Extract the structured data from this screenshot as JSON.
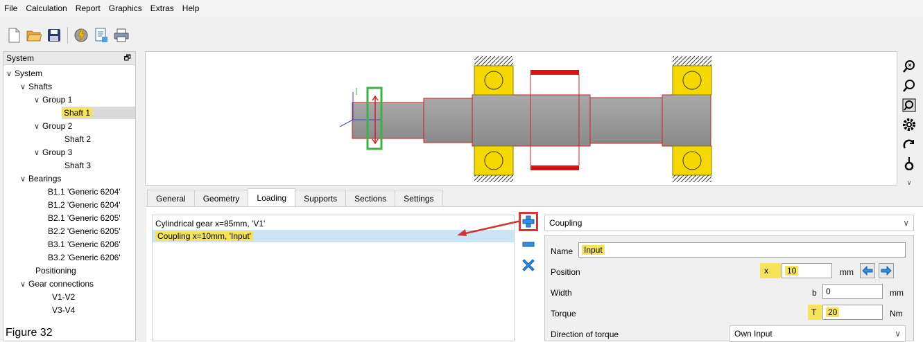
{
  "menu": [
    "File",
    "Calculation",
    "Report",
    "Graphics",
    "Extras",
    "Help"
  ],
  "toolbar": {
    "icons": [
      "new-document-icon",
      "open-folder-icon",
      "save-icon",
      "calculate-icon",
      "report-icon",
      "print-icon"
    ]
  },
  "system_panel": {
    "title": "System",
    "tree": [
      {
        "label": "System",
        "level": 0,
        "expanded": true
      },
      {
        "label": "Shafts",
        "level": 1,
        "expanded": true
      },
      {
        "label": "Group 1",
        "level": 2,
        "expanded": true
      },
      {
        "label": "Shaft 1",
        "level": 3,
        "selected": true
      },
      {
        "label": "Group 2",
        "level": 2,
        "expanded": true
      },
      {
        "label": "Shaft 2",
        "level": 3
      },
      {
        "label": "Group 3",
        "level": 2,
        "expanded": true
      },
      {
        "label": "Shaft 3",
        "level": 3
      },
      {
        "label": "Bearings",
        "level": 1,
        "expanded": true
      },
      {
        "label": "B1.1 'Generic 6204'",
        "level": 2
      },
      {
        "label": "B1.2 'Generic 6204'",
        "level": 2
      },
      {
        "label": "B2.1 'Generic 6205'",
        "level": 2
      },
      {
        "label": "B2.2 'Generic 6205'",
        "level": 2
      },
      {
        "label": "B3.1 'Generic 6206'",
        "level": 2
      },
      {
        "label": "B3.2 'Generic 6206'",
        "level": 2
      },
      {
        "label": "Positioning",
        "level": 1
      },
      {
        "label": "Gear connections",
        "level": 1,
        "expanded": true
      },
      {
        "label": "V1-V2",
        "level": 2
      },
      {
        "label": "V3-V4",
        "level": 2
      }
    ]
  },
  "figure_caption": "Figure 32",
  "view_tools": [
    "zoom-fit-icon",
    "zoom-in-icon",
    "zoom-window-icon",
    "settings-gear-icon",
    "rotate-icon",
    "force-icon",
    "expand-chevron-icon"
  ],
  "tabs": [
    "General",
    "Geometry",
    "Loading",
    "Supports",
    "Sections",
    "Settings"
  ],
  "active_tab": "Loading",
  "loads": [
    {
      "label": "Cylindrical gear  x=85mm, 'V1'",
      "selected": false
    },
    {
      "label": "Coupling  x=10mm, 'Input'",
      "selected": true
    }
  ],
  "side_buttons": [
    "add-icon",
    "remove-icon",
    "delete-all-icon"
  ],
  "load_type": "Coupling",
  "properties": {
    "name_label": "Name",
    "name_value": "Input",
    "position_label": "Position",
    "position_symbol": "x",
    "position_value": "10",
    "position_unit": "mm",
    "width_label": "Width",
    "width_symbol": "b",
    "width_value": "0",
    "width_unit": "mm",
    "torque_label": "Torque",
    "torque_symbol": "T",
    "torque_value": "20",
    "torque_unit": "Nm",
    "direction_label": "Direction of torque",
    "direction_value": "Own Input"
  },
  "colors": {
    "highlight": "#f7e35a",
    "selection": "#cce4f7",
    "annotation_red": "#d33333",
    "shaft_outline": "#cc2222",
    "bearing_yellow": "#f5d800",
    "coupling_marker": "#3cb043"
  }
}
